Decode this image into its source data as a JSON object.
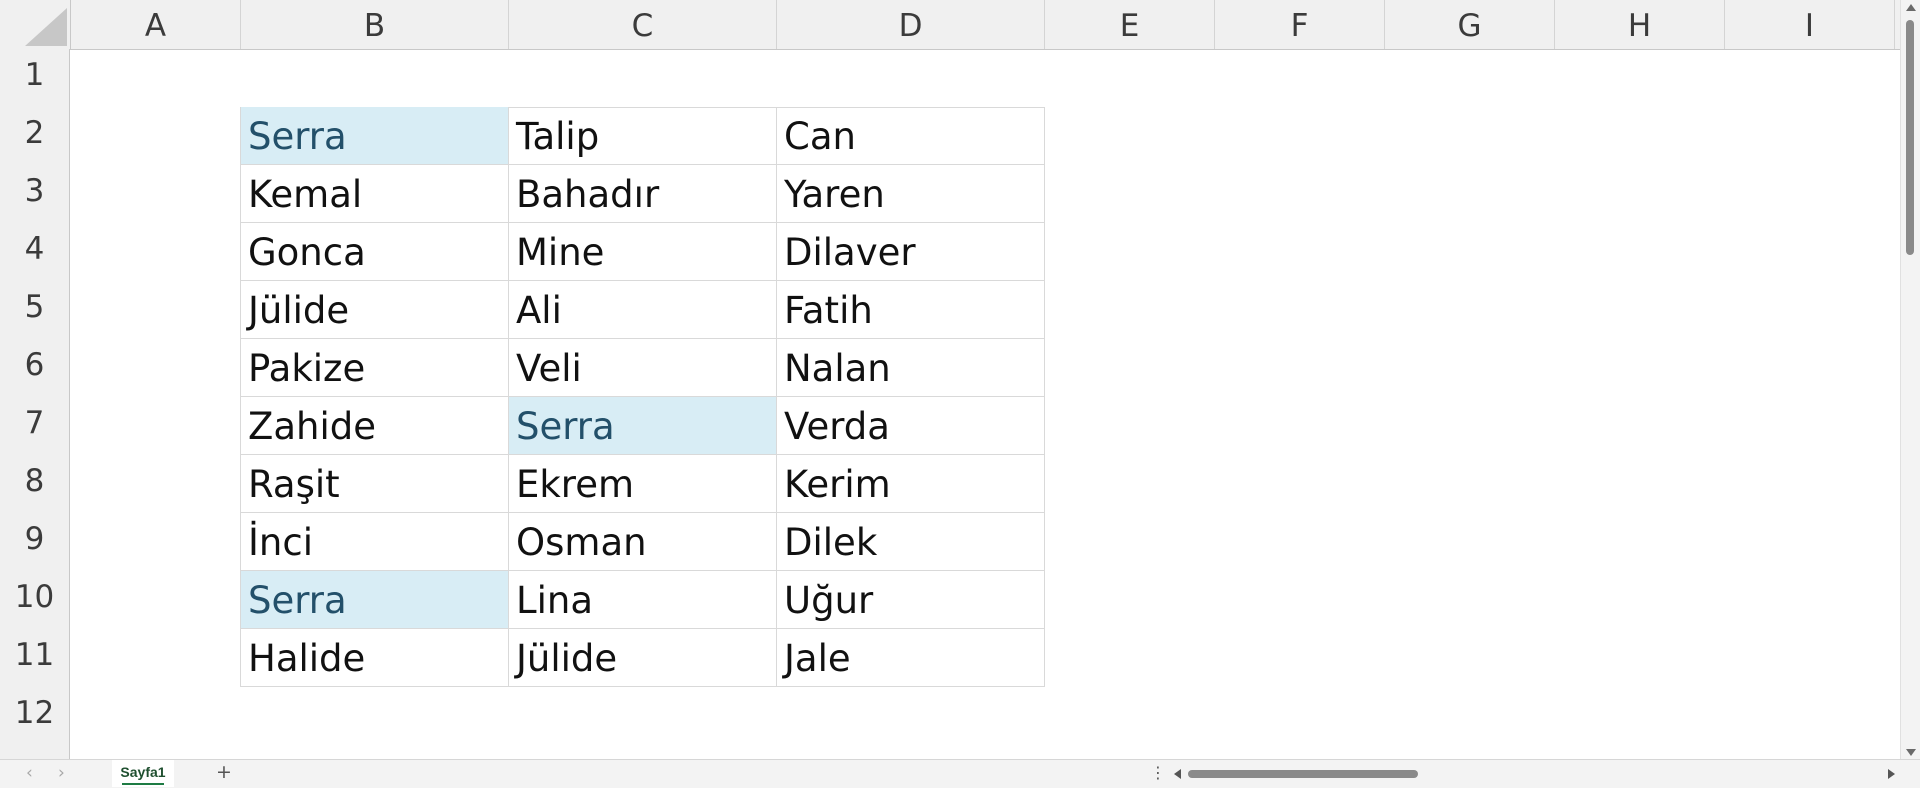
{
  "spreadsheet": {
    "columns": [
      "A",
      "B",
      "C",
      "D",
      "E",
      "F",
      "G",
      "H",
      "I"
    ],
    "rows": [
      "1",
      "2",
      "3",
      "4",
      "5",
      "6",
      "7",
      "8",
      "9",
      "10",
      "11",
      "12"
    ],
    "table": [
      [
        "Serra",
        "Talip",
        "Can"
      ],
      [
        "Kemal",
        "Bahadır",
        "Yaren"
      ],
      [
        "Gonca",
        "Mine",
        "Dilaver"
      ],
      [
        "Jülide",
        "Ali",
        "Fatih"
      ],
      [
        "Pakize",
        "Veli",
        "Nalan"
      ],
      [
        "Zahide",
        "Serra",
        "Verda"
      ],
      [
        "Raşit",
        "Ekrem",
        "Kerim"
      ],
      [
        "İnci",
        "Osman",
        "Dilek"
      ],
      [
        "Serra",
        "Lina",
        "Uğur"
      ],
      [
        "Halide",
        "Jülide",
        "Jale"
      ]
    ],
    "highlighted_cells": [
      "B2",
      "C7",
      "B10"
    ],
    "highlight_fill": "#d8edf5",
    "highlight_text": "#23506a"
  },
  "sheet_tabs": {
    "active": "Sayfa1",
    "add_label": "+",
    "prev_label": "‹",
    "next_label": "›",
    "more_label": "⋮"
  },
  "colors": {
    "header_bg": "#f0f0f0",
    "gridline": "#d9d9d9",
    "accent": "#1e7b44"
  }
}
